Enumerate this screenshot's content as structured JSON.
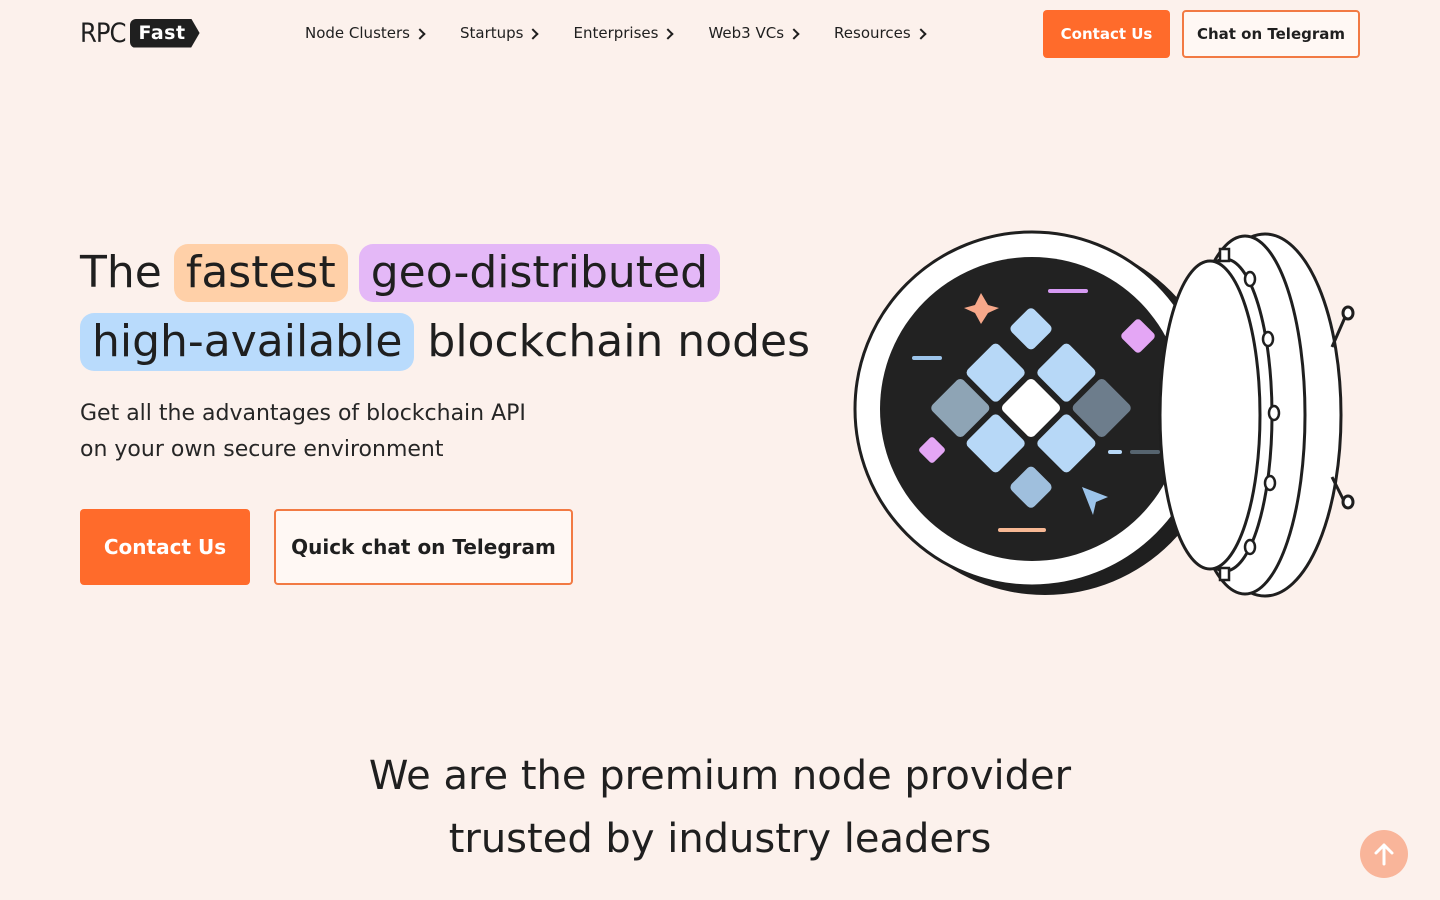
{
  "header": {
    "logo": {
      "left": "RPC",
      "right": "Fast"
    },
    "nav": [
      {
        "label": "Node Clusters"
      },
      {
        "label": "Startups"
      },
      {
        "label": "Enterprises"
      },
      {
        "label": "Web3 VCs"
      },
      {
        "label": "Resources"
      }
    ],
    "contact_label": "Contact Us",
    "telegram_label": "Chat on Telegram"
  },
  "hero": {
    "word_the": "The",
    "word_fastest": "fastest",
    "word_geo": "geo-distributed",
    "word_high": "high-available",
    "word_rest": "blockchain nodes",
    "sub_line1": "Get all the advantages of blockchain API",
    "sub_line2": "on your own secure environment",
    "contact_label": "Contact Us",
    "telegram_label": "Quick chat on Telegram"
  },
  "section": {
    "title_line1": "We are the premium node provider",
    "title_line2": "trusted by industry leaders"
  },
  "icons": {
    "scroll_top": "arrow-up-icon",
    "nav_chevron": "chevron-right-icon",
    "illustration": "vault-door-illustration"
  },
  "colors": {
    "background": "#fcf1ec",
    "accent": "#ff6b2b",
    "pill_orange": "#ffd0a8",
    "pill_purple": "#e4b8f7",
    "pill_blue": "#b9dbfc"
  }
}
